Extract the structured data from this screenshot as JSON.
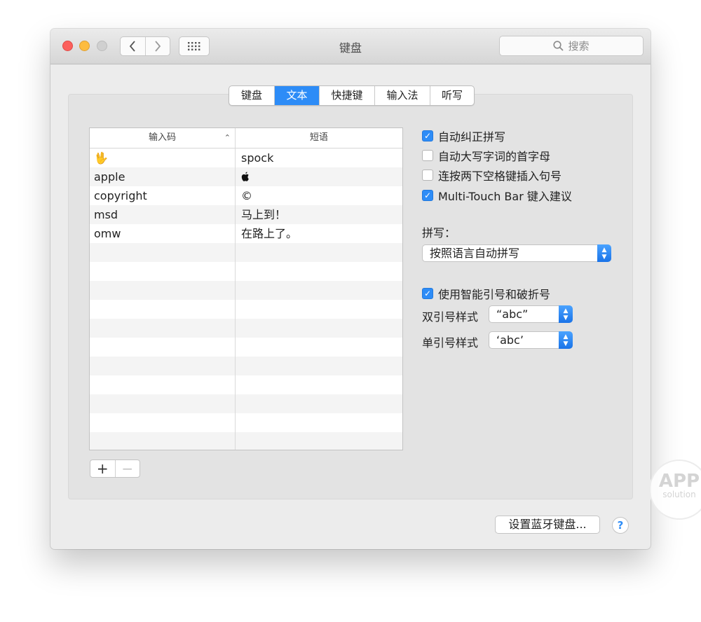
{
  "window": {
    "title": "键盘"
  },
  "toolbar": {
    "back_icon": "chevron-left-icon",
    "forward_icon": "chevron-right-icon",
    "grid_icon": "grid-icon"
  },
  "search": {
    "placeholder": "搜索"
  },
  "tabs": [
    {
      "label": "键盘",
      "active": false
    },
    {
      "label": "文本",
      "active": true
    },
    {
      "label": "快捷键",
      "active": false
    },
    {
      "label": "输入法",
      "active": false
    },
    {
      "label": "听写",
      "active": false
    }
  ],
  "table": {
    "headers": {
      "input": "输入码",
      "phrase": "短语"
    },
    "rows": [
      {
        "input": "🖖",
        "phrase": "spock"
      },
      {
        "input": "apple",
        "phrase": ""
      },
      {
        "input": "copyright",
        "phrase": "©"
      },
      {
        "input": "msd",
        "phrase": "马上到！"
      },
      {
        "input": "omw",
        "phrase": "在路上了。"
      }
    ]
  },
  "options": [
    {
      "label": "自动纠正拼写",
      "checked": true
    },
    {
      "label": "自动大写字词的首字母",
      "checked": false
    },
    {
      "label": "连按两下空格键插入句号",
      "checked": false
    },
    {
      "label": "Multi-Touch Bar 键入建议",
      "checked": true
    }
  ],
  "spelling": {
    "label": "拼写：",
    "value": "按照语言自动拼写"
  },
  "smart_quotes": {
    "label": "使用智能引号和破折号",
    "checked": true,
    "double_label": "双引号样式",
    "double_value": "“abc”",
    "single_label": "单引号样式",
    "single_value": "‘abc’"
  },
  "buttons": {
    "add": "+",
    "remove": "−",
    "bluetooth": "设置蓝牙键盘...",
    "help": "?"
  },
  "watermark": {
    "line1": "APP",
    "line2": "solution"
  },
  "colors": {
    "accent": "#2d8cf7"
  }
}
